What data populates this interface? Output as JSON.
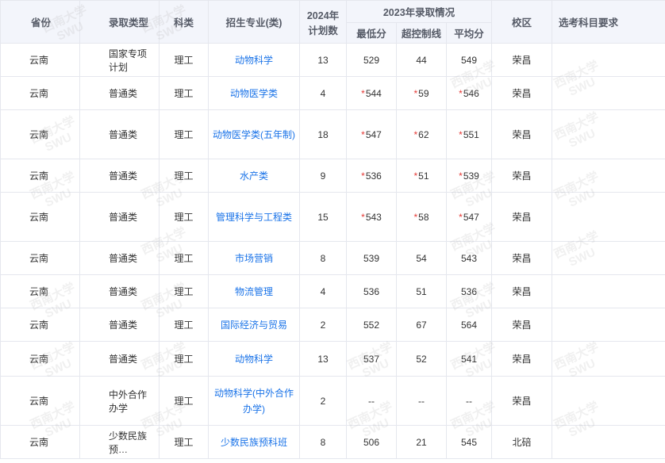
{
  "header": {
    "province": "省份",
    "admission_type": "录取类型",
    "subject": "科类",
    "major": "招生专业(类)",
    "plan_2024_line1": "2024年",
    "plan_2024_line2": "计划数",
    "admission_2023": "2023年录取情况",
    "min_score": "最低分",
    "over_control": "超控制线",
    "avg_score": "平均分",
    "campus": "校区",
    "subject_requirements": "选考科目要求"
  },
  "rows": [
    {
      "province": "云南",
      "type": "国家专项计划",
      "subject": "理工",
      "major": "动物科学",
      "plan": "13",
      "min": "529",
      "min_star": false,
      "over": "44",
      "over_star": false,
      "avg": "549",
      "avg_star": false,
      "campus": "荣昌",
      "req": ""
    },
    {
      "province": "云南",
      "type": "普通类",
      "subject": "理工",
      "major": "动物医学类",
      "plan": "4",
      "min": "544",
      "min_star": true,
      "over": "59",
      "over_star": true,
      "avg": "546",
      "avg_star": true,
      "campus": "荣昌",
      "req": ""
    },
    {
      "province": "云南",
      "type": "普通类",
      "subject": "理工",
      "major": "动物医学类(五年制)",
      "plan": "18",
      "min": "547",
      "min_star": true,
      "over": "62",
      "over_star": true,
      "avg": "551",
      "avg_star": true,
      "campus": "荣昌",
      "req": ""
    },
    {
      "province": "云南",
      "type": "普通类",
      "subject": "理工",
      "major": "水产类",
      "plan": "9",
      "min": "536",
      "min_star": true,
      "over": "51",
      "over_star": true,
      "avg": "539",
      "avg_star": true,
      "campus": "荣昌",
      "req": ""
    },
    {
      "province": "云南",
      "type": "普通类",
      "subject": "理工",
      "major": "管理科学与工程类",
      "plan": "15",
      "min": "543",
      "min_star": true,
      "over": "58",
      "over_star": true,
      "avg": "547",
      "avg_star": true,
      "campus": "荣昌",
      "req": ""
    },
    {
      "province": "云南",
      "type": "普通类",
      "subject": "理工",
      "major": "市场营销",
      "plan": "8",
      "min": "539",
      "min_star": false,
      "over": "54",
      "over_star": false,
      "avg": "543",
      "avg_star": false,
      "campus": "荣昌",
      "req": ""
    },
    {
      "province": "云南",
      "type": "普通类",
      "subject": "理工",
      "major": "物流管理",
      "plan": "4",
      "min": "536",
      "min_star": false,
      "over": "51",
      "over_star": false,
      "avg": "536",
      "avg_star": false,
      "campus": "荣昌",
      "req": ""
    },
    {
      "province": "云南",
      "type": "普通类",
      "subject": "理工",
      "major": "国际经济与贸易",
      "plan": "2",
      "min": "552",
      "min_star": false,
      "over": "67",
      "over_star": false,
      "avg": "564",
      "avg_star": false,
      "campus": "荣昌",
      "req": ""
    },
    {
      "province": "云南",
      "type": "普通类",
      "subject": "理工",
      "major": "动物科学",
      "plan": "13",
      "min": "537",
      "min_star": false,
      "over": "52",
      "over_star": false,
      "avg": "541",
      "avg_star": false,
      "campus": "荣昌",
      "req": ""
    },
    {
      "province": "云南",
      "type": "中外合作办学",
      "subject": "理工",
      "major": "动物科学(中外合作办学)",
      "plan": "2",
      "min": "--",
      "min_star": false,
      "over": "--",
      "over_star": false,
      "avg": "--",
      "avg_star": false,
      "campus": "荣昌",
      "req": ""
    },
    {
      "province": "云南",
      "type": "少数民族预…",
      "subject": "理工",
      "major": "少数民族预科班",
      "plan": "8",
      "min": "506",
      "min_star": false,
      "over": "21",
      "over_star": false,
      "avg": "545",
      "avg_star": false,
      "campus": "北碚",
      "req": ""
    }
  ],
  "star_symbol": "*",
  "watermark": {
    "line1": "西南大学",
    "line2": "SWU"
  }
}
